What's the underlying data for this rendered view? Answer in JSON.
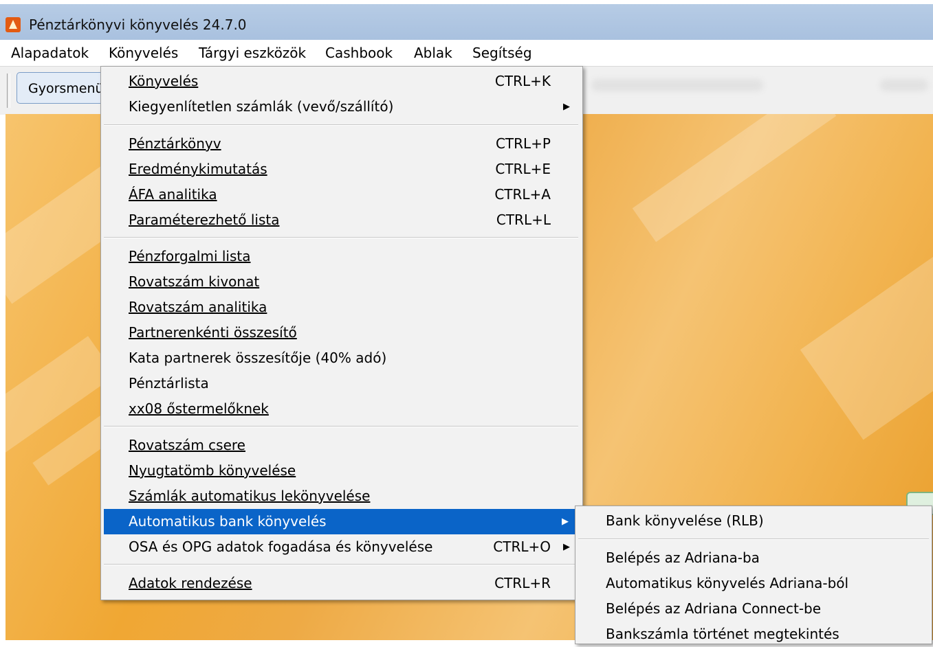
{
  "window": {
    "title": "Pénztárkönyvi könyvelés 24.7.0"
  },
  "menubar": [
    "Alapadatok",
    "Könyvelés",
    "Tárgyi eszközök",
    "Cashbook",
    "Ablak",
    "Segítség"
  ],
  "toolbar": {
    "quick_button": "Gyorsmenü"
  },
  "konyveles_menu": [
    {
      "label": "Könyvelés",
      "shortcut": "CTRL+K"
    },
    {
      "label": "Kiegyenlítetlen számlák (vevő/szállító)",
      "shortcut": "",
      "submenu": true
    },
    {
      "label": "Pénztárkönyv",
      "shortcut": "CTRL+P"
    },
    {
      "label": "Eredménykimutatás",
      "shortcut": "CTRL+E"
    },
    {
      "label": "ÁFA analitika",
      "shortcut": "CTRL+A"
    },
    {
      "label": "Paraméterezhető lista",
      "shortcut": "CTRL+L"
    },
    {
      "label": "Pénzforgalmi lista",
      "shortcut": ""
    },
    {
      "label": "Rovatszám kivonat",
      "shortcut": ""
    },
    {
      "label": "Rovatszám analitika",
      "shortcut": ""
    },
    {
      "label": "Partnerenkénti összesítő",
      "shortcut": ""
    },
    {
      "label": "Kata partnerek összesítője (40% adó)",
      "shortcut": ""
    },
    {
      "label": "Pénztárlista",
      "shortcut": ""
    },
    {
      "label": "xx08 őstermelőknek",
      "shortcut": ""
    },
    {
      "label": "Rovatszám csere",
      "shortcut": ""
    },
    {
      "label": "Nyugtatömb könyvelése",
      "shortcut": ""
    },
    {
      "label": "Számlák automatikus lekönyvelése",
      "shortcut": ""
    },
    {
      "label": "Automatikus bank könyvelés",
      "shortcut": "",
      "submenu": true,
      "highlighted": true
    },
    {
      "label": "OSA és OPG adatok fogadása és könyvelése",
      "shortcut": "CTRL+O",
      "submenu": true
    },
    {
      "label": "Adatok rendezése",
      "shortcut": "CTRL+R"
    }
  ],
  "bank_submenu": [
    {
      "label": "Bank könyvelése (RLB)"
    },
    {
      "label": "Belépés az Adriana-ba"
    },
    {
      "label": "Automatikus könyvelés Adriana-ból"
    },
    {
      "label": "Belépés az Adriana Connect-be"
    },
    {
      "label": "Bankszámla történet megtekintés"
    }
  ]
}
